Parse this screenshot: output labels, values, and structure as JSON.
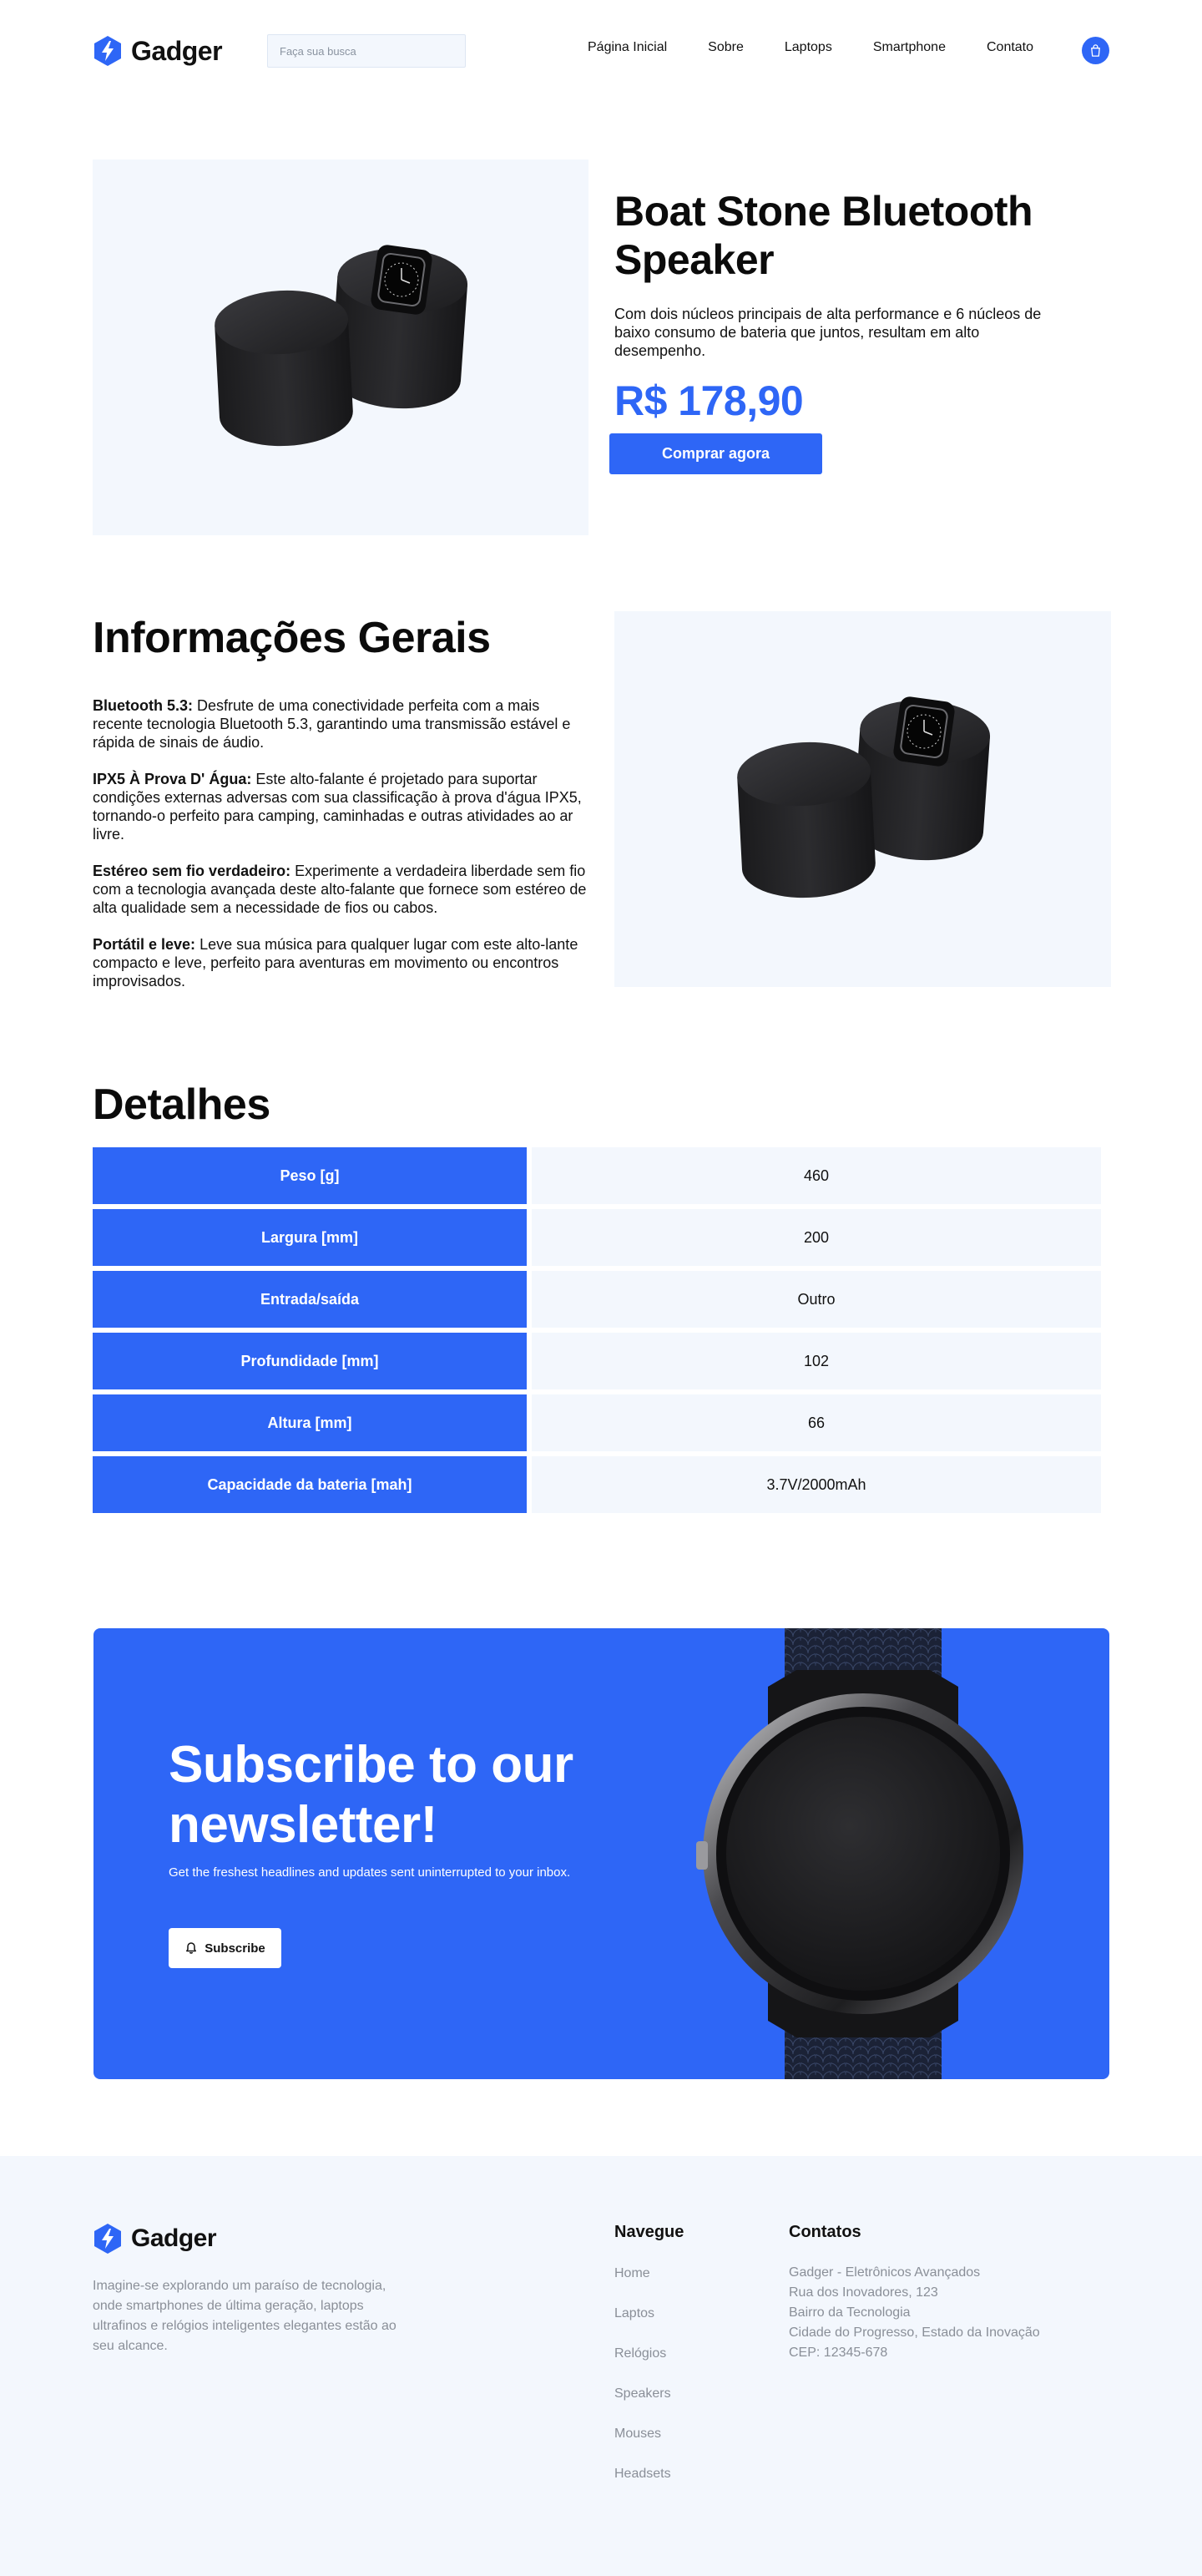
{
  "header": {
    "brand": "Gadger",
    "search_placeholder": "Faça sua busca",
    "nav": [
      "Página Inicial",
      "Sobre",
      "Laptops",
      "Smartphone",
      "Contato"
    ],
    "cart_icon": "shopping-bag-icon"
  },
  "product": {
    "title": "Boat Stone Bluetooth Speaker",
    "description": "Com dois núcleos principais de alta performance e 6 núcleos de baixo consumo de bateria que juntos, resultam em alto desempenho.",
    "price": "R$ 178,90",
    "buy_label": "Comprar agora"
  },
  "info": {
    "title": "Informações Gerais",
    "items": [
      {
        "label": "Bluetooth 5.3:",
        "text": "Desfrute de uma conectividade perfeita com a mais recente tecnologia Bluetooth 5.3, garantindo uma transmissão estável e rápida de sinais de áudio."
      },
      {
        "label": "IPX5 À Prova D' Água:",
        "text": "Este alto-falante é projetado para suportar condições externas adversas com sua classificação à prova d'água IPX5, tornando-o perfeito para camping, caminhadas e outras atividades ao ar livre."
      },
      {
        "label": "Estéreo sem fio verdadeiro:",
        "text": "Experimente a verdadeira liberdade sem fio com a tecnologia avançada deste alto-falante que fornece som estéreo de alta qualidade sem a necessidade de fios ou cabos."
      },
      {
        "label": "Portátil e leve:",
        "text": "Leve sua música para qualquer lugar com este alto-lante compacto e leve, perfeito para aventuras em movimento ou encontros improvisados."
      }
    ]
  },
  "details": {
    "title": "Detalhes",
    "rows": [
      {
        "key": "Peso [g]",
        "value": "460"
      },
      {
        "key": "Largura [mm]",
        "value": "200"
      },
      {
        "key": "Entrada/saída",
        "value": "Outro"
      },
      {
        "key": "Profundidade [mm]",
        "value": "102"
      },
      {
        "key": "Altura [mm]",
        "value": "66"
      },
      {
        "key": "Capacidade da bateria [mah]",
        "value": "3.7V/2000mAh"
      }
    ]
  },
  "newsletter": {
    "title": "Subscribe to our newsletter!",
    "text": "Get the freshest headlines and updates sent uninterrupted to your inbox.",
    "button_label": "Subscribe",
    "button_icon": "bell-icon"
  },
  "footer": {
    "brand": "Gadger",
    "about": "Imagine-se explorando um paraíso de tecnologia, onde smartphones de última geração, laptops ultrafinos e relógios inteligentes elegantes estão ao seu alcance.",
    "nav_title": "Navegue",
    "nav": [
      "Home",
      "Laptos",
      "Relógios",
      "Speakers",
      "Mouses",
      "Headsets"
    ],
    "contact_title": "Contatos",
    "contact_lines": [
      "Gadger - Eletrônicos Avançados",
      "Rua dos Inovadores, 123",
      "Bairro da Tecnologia",
      "Cidade do Progresso, Estado da Inovação",
      "CEP: 12345-678"
    ]
  },
  "colors": {
    "accent": "#2e66f6",
    "panel": "#f3f7fd",
    "text": "#111111",
    "muted": "#8a8f98"
  }
}
